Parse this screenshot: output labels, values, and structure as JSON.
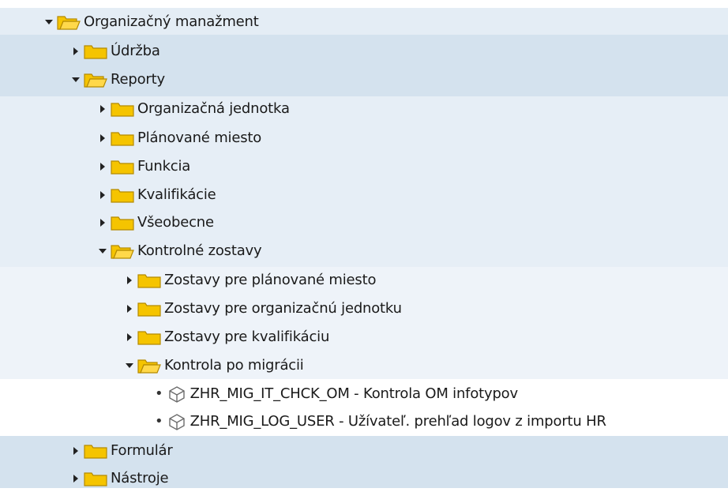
{
  "colors": {
    "band_light": "#e6eef6",
    "band_dark": "#d6e3ef",
    "white": "#ffffff",
    "folder_fill": "#f5c400",
    "folder_stroke": "#c99a00"
  },
  "tree": {
    "root": {
      "label": "Organizačný manažment",
      "expanded": true
    },
    "udrzba": {
      "label": "Údržba",
      "expanded": false
    },
    "reporty": {
      "label": "Reporty",
      "expanded": true
    },
    "org_jednotka": {
      "label": "Organizačná jednotka",
      "expanded": false
    },
    "planovane_miesto": {
      "label": "Plánované miesto",
      "expanded": false
    },
    "funkcia": {
      "label": "Funkcia",
      "expanded": false
    },
    "kvalifikacie": {
      "label": "Kvalifikácie",
      "expanded": false
    },
    "vseobecne": {
      "label": "Všeobecne",
      "expanded": false
    },
    "kontrolne_zostavy": {
      "label": "Kontrolné zostavy",
      "expanded": true
    },
    "zostavy_planovane": {
      "label": "Zostavy pre plánované miesto",
      "expanded": false
    },
    "zostavy_org": {
      "label": "Zostavy pre organizačnú jednotku",
      "expanded": false
    },
    "zostavy_kval": {
      "label": "Zostavy pre kvalifikáciu",
      "expanded": false
    },
    "kontrola_po_migracii": {
      "label": "Kontrola po migrácii",
      "expanded": true
    },
    "report_chck_om": {
      "label": "ZHR_MIG_IT_CHCK_OM - Kontrola OM infotypov"
    },
    "report_log_user": {
      "label": "ZHR_MIG_LOG_USER - Užívateľ. prehľad logov z importu HR"
    },
    "formular": {
      "label": "Formulár",
      "expanded": false
    },
    "nastroje": {
      "label": "Nástroje",
      "expanded": false
    }
  }
}
